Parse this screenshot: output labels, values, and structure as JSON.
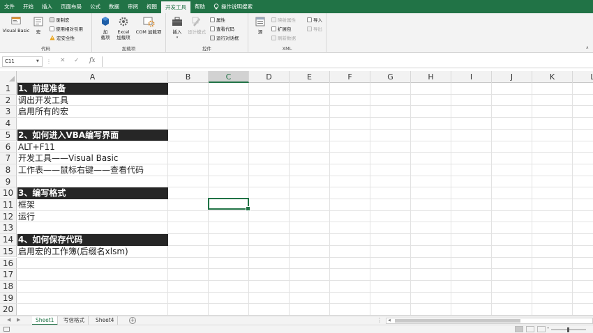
{
  "tabs": [
    "文件",
    "开始",
    "插入",
    "页面布局",
    "公式",
    "数据",
    "审阅",
    "视图",
    "开发工具",
    "帮助"
  ],
  "active_tab": "开发工具",
  "tell_me": "操作说明搜索",
  "ribbon": {
    "code": {
      "label": "代码",
      "visual_basic": "Visual Basic",
      "macros": "宏",
      "record_macro": "录制宏",
      "relative_ref": "使用相对引用",
      "macro_security": "宏安全性"
    },
    "addins": {
      "label": "加载项",
      "addins_btn": "加\n载项",
      "excel_addins": "Excel\n加载项",
      "com_addins": "COM 加载项"
    },
    "controls": {
      "label": "控件",
      "insert": "插入",
      "design_mode": "设计模式",
      "properties": "属性",
      "view_code": "查看代码",
      "run_dialog": "运行对话框"
    },
    "xml": {
      "label": "XML",
      "source": "源",
      "map_props": "映射属性",
      "expansion_packs": "扩展包",
      "refresh_data": "刷新数据",
      "import": "导入",
      "export": "导出"
    }
  },
  "formula_bar": {
    "name_box": "C11",
    "fx": "fx",
    "value": ""
  },
  "columns": [
    "A",
    "B",
    "C",
    "D",
    "E",
    "F",
    "G",
    "H",
    "I",
    "J",
    "K",
    "L"
  ],
  "selected_column": "C",
  "rows": [
    "1",
    "2",
    "3",
    "4",
    "5",
    "6",
    "7",
    "8",
    "9",
    "10",
    "11",
    "12",
    "13",
    "14",
    "15",
    "16",
    "17",
    "18",
    "19",
    "20"
  ],
  "cells": [
    {
      "row": 1,
      "text": "1、前提准备",
      "header": true
    },
    {
      "row": 2,
      "text": "调出开发工具",
      "header": false
    },
    {
      "row": 3,
      "text": "启用所有的宏",
      "header": false
    },
    {
      "row": 5,
      "text": "2、如何进入VBA编写界面",
      "header": true
    },
    {
      "row": 6,
      "text": "ALT+F11",
      "header": false
    },
    {
      "row": 7,
      "text": "开发工具——Visual Basic",
      "header": false
    },
    {
      "row": 8,
      "text": "工作表——鼠标右键——查看代码",
      "header": false
    },
    {
      "row": 10,
      "text": "3、编写格式",
      "header": true
    },
    {
      "row": 11,
      "text": "框架",
      "header": false
    },
    {
      "row": 12,
      "text": "运行",
      "header": false
    },
    {
      "row": 14,
      "text": "4、如何保存代码",
      "header": true
    },
    {
      "row": 15,
      "text": "启用宏的工作簿(后缀名xlsm)",
      "header": false
    }
  ],
  "sheets": [
    "Sheet1",
    "写信格式",
    "Sheet4"
  ],
  "active_sheet": "Sheet1",
  "colors": {
    "accent": "#217346",
    "header_fill": "#262626"
  }
}
